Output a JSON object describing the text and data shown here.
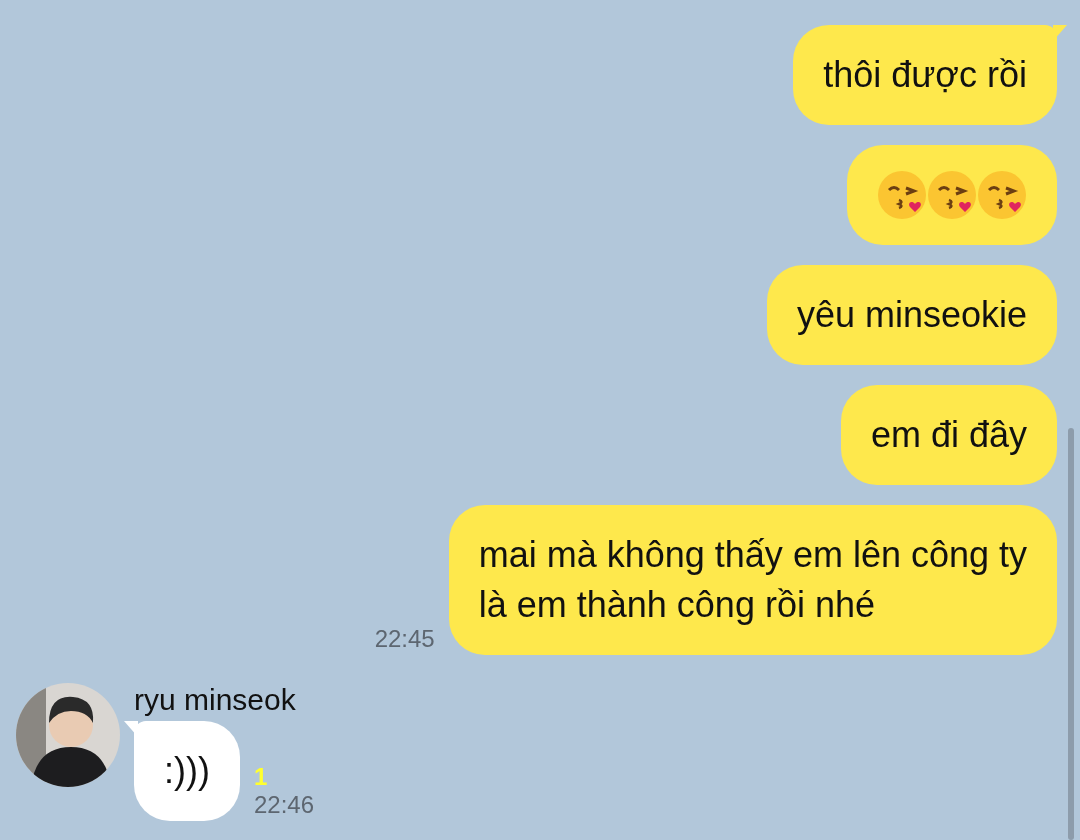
{
  "messages": [
    {
      "outgoing": true,
      "kind": "text",
      "text": "thôi được rồi"
    },
    {
      "outgoing": true,
      "kind": "stickers"
    },
    {
      "outgoing": true,
      "kind": "text",
      "text": "yêu minseokie"
    },
    {
      "outgoing": true,
      "kind": "text",
      "text": "em đi đây"
    },
    {
      "outgoing": true,
      "kind": "text",
      "text": "mai mà không thấy em lên công ty\nlà em thành công rồi nhé",
      "time": "22:45"
    },
    {
      "outgoing": false,
      "kind": "text",
      "sender": "ryu minseok",
      "text": ":)))",
      "unread": "1",
      "time": "22:46"
    }
  ]
}
